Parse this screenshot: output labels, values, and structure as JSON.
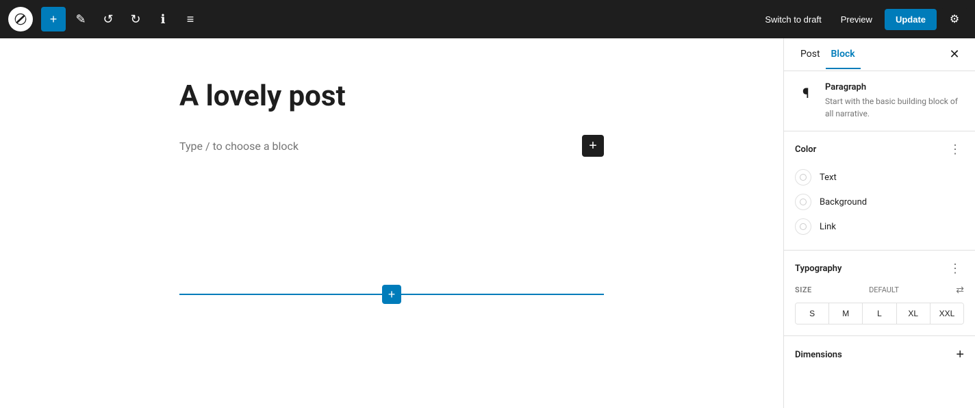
{
  "toolbar": {
    "add_label": "+",
    "undo_label": "↺",
    "redo_label": "↻",
    "info_label": "ℹ",
    "list_label": "≡",
    "switch_draft_label": "Switch to draft",
    "preview_label": "Preview",
    "update_label": "Update"
  },
  "editor": {
    "post_title": "A lovely post",
    "placeholder_text": "Type / to choose a block"
  },
  "sidebar": {
    "tab_post_label": "Post",
    "tab_block_label": "Block",
    "block_name": "Paragraph",
    "block_description": "Start with the basic building block of all narrative.",
    "color_section_title": "Color",
    "color_text_label": "Text",
    "color_background_label": "Background",
    "color_link_label": "Link",
    "typography_section_title": "Typography",
    "size_label": "SIZE",
    "size_default_label": "DEFAULT",
    "size_options": [
      "S",
      "M",
      "L",
      "XL",
      "XXL"
    ],
    "dimensions_section_title": "Dimensions"
  }
}
